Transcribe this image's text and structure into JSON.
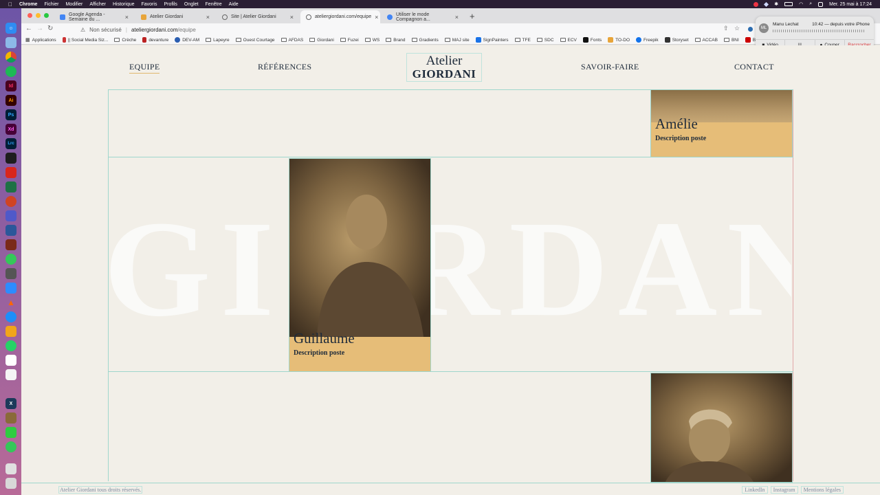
{
  "menubar": {
    "app": "Chrome",
    "items": [
      "Fichier",
      "Modifier",
      "Afficher",
      "Historique",
      "Favoris",
      "Profils",
      "Onglet",
      "Fenêtre",
      "Aide"
    ],
    "clock": "Mer. 25 mai à 17:24"
  },
  "tabs": [
    {
      "title": "Google Agenda - Semaine du ...",
      "color": "#4285f4"
    },
    {
      "title": "Atelier Giordani",
      "color": "#e8a53a"
    },
    {
      "title": "Site | Atelier Giordani",
      "color": "#666666"
    },
    {
      "title": "ateliergiordani.com/equipe",
      "color": "#666666",
      "active": true
    },
    {
      "title": "Utiliser le mode Compagnon a...",
      "color": "#4285f4"
    }
  ],
  "address": {
    "warning": "Non sécurisé",
    "host": "ateliergiordani.com",
    "path": "/equipe"
  },
  "bookmarks": [
    "Applications",
    "|| Social Media Siz...",
    "Crèche",
    "devanture",
    "DEV-AM",
    "Lapeyre",
    "Ouest Courtage",
    "AFDAS",
    "Giordani",
    "Fuzei",
    "WS",
    "Brand",
    "Gradients",
    "MAJ site",
    "SignPainters",
    "TFE",
    "SDC",
    "ECV",
    "Fonts",
    "TO-DO",
    "Freepik",
    "Storyset",
    "ACCAB",
    "BNI",
    "Banqu"
  ],
  "notification": {
    "initials": "ML",
    "name": "Manu Lechat",
    "time": "10:42 — depuis votre iPhone",
    "actions": [
      "Vidéo",
      "|||",
      "Couper",
      "Raccrocher"
    ]
  },
  "site": {
    "nav": {
      "equipe": "EQUIPE",
      "references": "RÉFÉRENCES",
      "savoir": "SAVOIR-FAIRE",
      "contact": "CONTACT"
    },
    "logo": {
      "line1": "Atelier",
      "line2": "GIORDANI"
    },
    "bigword": "GIORDANI",
    "team": [
      {
        "name": "Amélie",
        "role": "Description poste"
      },
      {
        "name": "Guillaume",
        "role": "Description poste"
      }
    ],
    "footer": {
      "copyright": "Atelier Giordani tous droits réservés.",
      "links": [
        "LinkedIn",
        "Instagram",
        "Mentions légales"
      ]
    }
  }
}
